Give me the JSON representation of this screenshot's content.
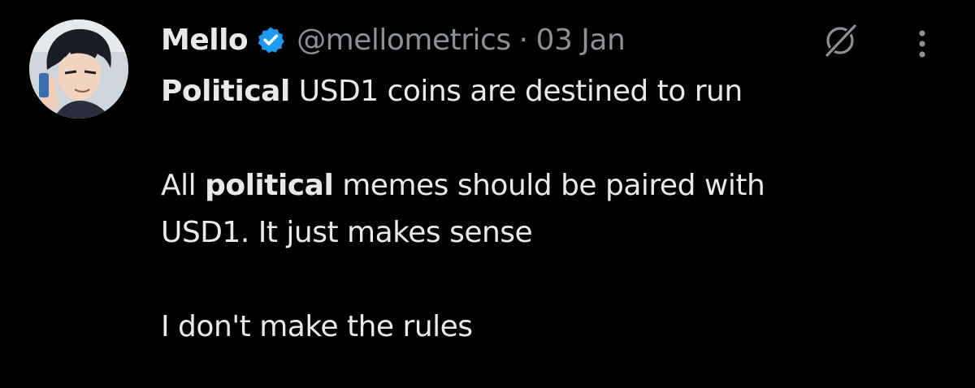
{
  "author": {
    "display_name": "Mello",
    "handle": "@mellometrics",
    "separator": "·",
    "date": "03 Jan",
    "verified_badge": "verified-badge-icon",
    "avatar": "profile-avatar"
  },
  "tweet": {
    "line1_bold": "Political",
    "line1_rest": " USD1 coins are destined to run",
    "line2_pre": "All ",
    "line2_bold": "political",
    "line2_rest": " memes should be paired with",
    "line3": "USD1. It just makes sense",
    "line4": "I don't make the rules"
  },
  "actions": {
    "grok_icon": "grok-icon",
    "more_icon": "more-options-icon"
  },
  "colors": {
    "background": "#000000",
    "text": "#e7e9ea",
    "secondary": "#8b9096",
    "verified": "#1d9bf0"
  }
}
